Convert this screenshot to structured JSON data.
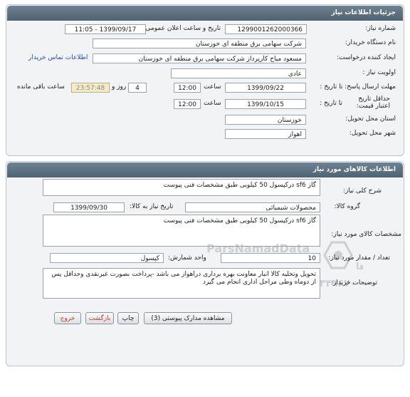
{
  "panel1": {
    "title": "جزئیات اطلاعات نیاز",
    "need_number_label": "شماره نیاز:",
    "need_number": "1299001262000366",
    "announce_label": "تاریخ و ساعت اعلان عمومی:",
    "announce_value": "1399/09/17 - 11:05",
    "buyer_label": "نام دستگاه خریدار:",
    "buyer_value": "شرکت سهامی برق منطقه ای خوزستان",
    "creator_label": "ایجاد کننده درخواست:",
    "creator_value": "مسعود میاح کارپرداز شرکت سهامی برق منطقه ای خوزستان",
    "contact_link": "اطلاعات تماس خریدار",
    "priority_label": "اولویت نیاز :",
    "priority_value": "عادی",
    "send_deadline_label": "مهلت ارسال پاسخ: تا تاریخ :",
    "send_deadline_date": "1399/09/22",
    "time_label": "ساعت",
    "send_deadline_time": "12:00",
    "days_value": "4",
    "days_label": "روز و",
    "remaining_time": "23:57:48",
    "remaining_label": "ساعت باقی مانده",
    "validity_label": "حداقل تاریخ اعتبار قیمت:",
    "validity_to": "تا تاریخ :",
    "validity_date": "1399/10/15",
    "validity_time": "12:00",
    "province_label": "استان محل تحویل:",
    "province_value": "خوزستان",
    "city_label": "شهر محل تحویل:",
    "city_value": "اهواز"
  },
  "panel2": {
    "title": "اطلاعات کالاهای مورد نیاز",
    "summary_label": "شرح کلی نیاز:",
    "summary_value": "گاز sf6 درکپسول 50 کیلویی طبق مشخصات فنی پیوست",
    "group_label": "گروه کالا:",
    "group_value": "محصولات شیمیائی",
    "need_date_label": "تاریخ نیاز به کالا:",
    "need_date": "1399/09/30",
    "specs_label": "مشخصات کالای مورد نیاز:",
    "specs_value": "گاز sf6 درکپسول 50 کیلویی طبق مشخصات فنی پیوست",
    "qty_label": "تعداد / مقدار مورد نیاز:",
    "qty_value": "10",
    "unit_label": "واحد شمارش:",
    "unit_value": "کپسول",
    "notes_label": "توضیحات خریدار:",
    "notes_value": "تحویل وتخلیه کالا انبار معاونت بهره برداری دراهواز می باشد -پرداخت بصورت غیرنقدی وحداقل پس از دوماه وطی مراحل اداری انجام می گیرد"
  },
  "watermark": {
    "brand": "ParsNamadData",
    "line1": "مرکز فرآوری اطلاعات پارس نماد داده ها",
    "phone": "۰۲۱-۸۸۳۴۹۶۷۰"
  },
  "buttons": {
    "print": "چاپ",
    "attachments": "مشاهده مدارک پیوستی (3)",
    "back": "بازگشت",
    "exit": "خروج"
  }
}
